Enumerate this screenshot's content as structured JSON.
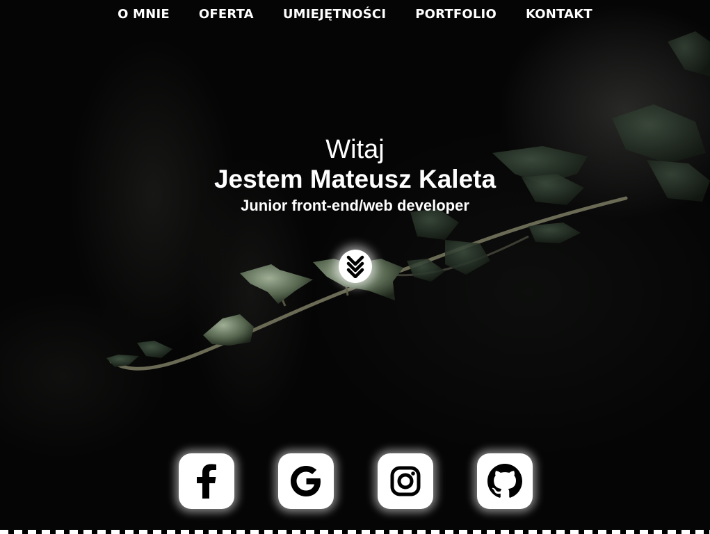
{
  "nav": {
    "items": [
      {
        "label": "O MNIE"
      },
      {
        "label": "OFERTA"
      },
      {
        "label": "UMIEJĘTNOŚCI"
      },
      {
        "label": "PORTFOLIO"
      },
      {
        "label": "KONTAKT"
      }
    ]
  },
  "hero": {
    "greeting": "Witaj",
    "name": "Jestem Mateusz Kaleta",
    "role": "Junior front-end/web developer"
  },
  "scroll_button": {
    "icon": "double-chevron-down-icon"
  },
  "social": {
    "items": [
      {
        "icon": "facebook-icon"
      },
      {
        "icon": "google-icon"
      },
      {
        "icon": "instagram-icon"
      },
      {
        "icon": "github-icon"
      }
    ]
  },
  "colors": {
    "text": "#ffffff",
    "background": "#050505",
    "button": "#ffffff",
    "icon": "#000000"
  }
}
